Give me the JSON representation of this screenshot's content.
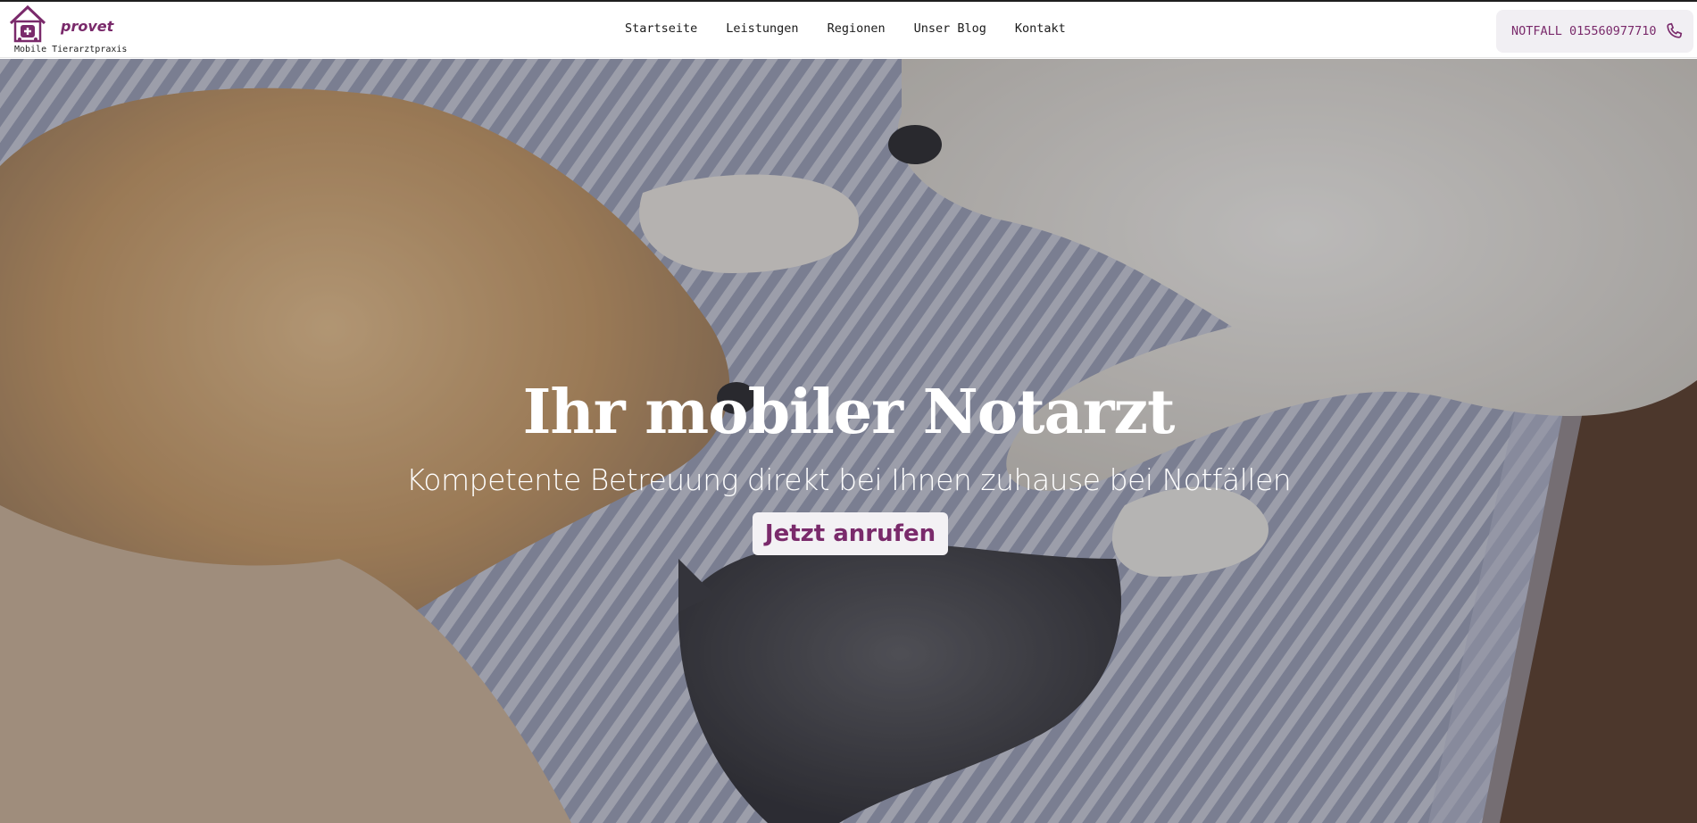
{
  "brand": {
    "name": "provet",
    "tagline": "Mobile Tierarztpraxis",
    "color": "#7a2a6b"
  },
  "nav": {
    "items": [
      {
        "label": "Startseite"
      },
      {
        "label": "Leistungen"
      },
      {
        "label": "Regionen"
      },
      {
        "label": "Unser Blog"
      },
      {
        "label": "Kontakt"
      }
    ]
  },
  "emergency": {
    "label": "NOTFALL 015560977710",
    "icon": "phone-icon"
  },
  "hero": {
    "title": "Ihr mobiler Notarzt",
    "subtitle": "Kompetente Betreuung direkt bei Ihnen zuhause bei Notfällen",
    "cta_label": "Jetzt anrufen",
    "background": "photo of sleeping dogs and a cat on a striped blanket"
  }
}
